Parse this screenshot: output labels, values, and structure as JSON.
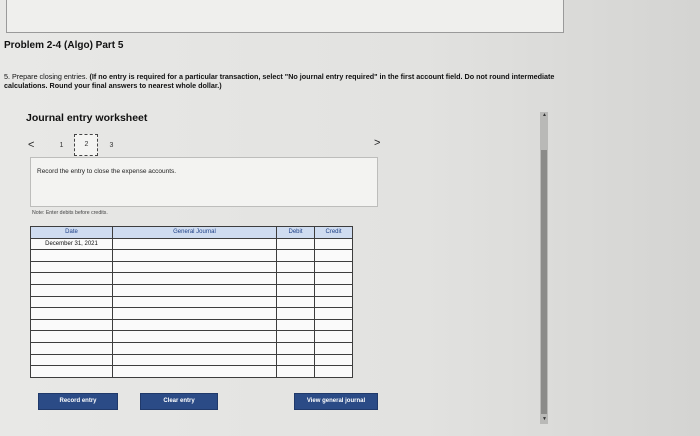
{
  "header": {
    "problem_title": "Problem 2-4 (Algo) Part 5"
  },
  "instructions": {
    "step": "5. Prepare closing entries.",
    "bold": "(If no entry is required for a particular transaction, select \"No journal entry required\" in the first account field. Do not round intermediate calculations. Round your final answers to nearest whole dollar.)"
  },
  "worksheet": {
    "title": "Journal entry worksheet",
    "pages": [
      "1",
      "2",
      "3"
    ],
    "active_page": "2",
    "prev_icon": "<",
    "next_icon": ">",
    "entry_instruction": "Record the entry to close the expense accounts.",
    "note": "Note: Enter debits before credits."
  },
  "table": {
    "headers": {
      "date": "Date",
      "account": "General Journal",
      "debit": "Debit",
      "credit": "Credit"
    },
    "first_date": "December 31, 2021",
    "row_count": 12
  },
  "buttons": {
    "record": "Record entry",
    "clear": "Clear entry",
    "view": "View general journal"
  }
}
